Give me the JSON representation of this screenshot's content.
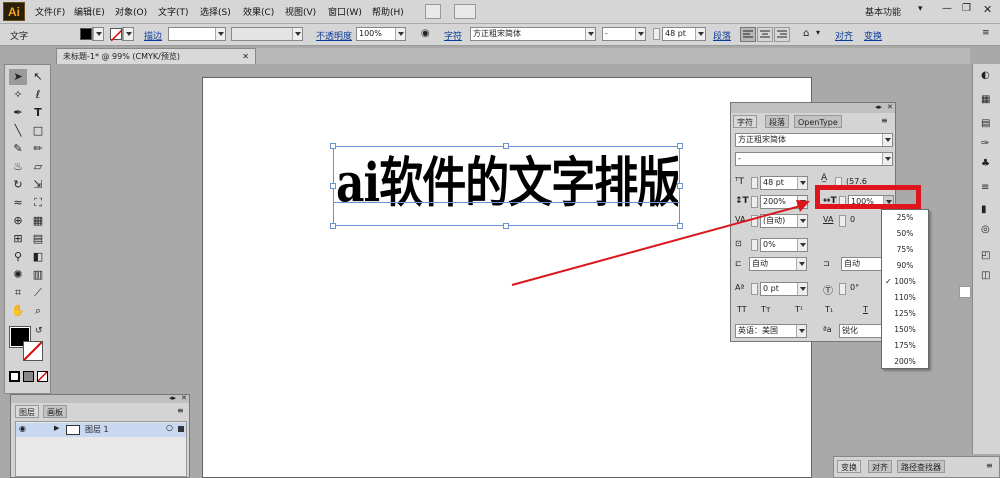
{
  "app": {
    "logo": "Ai",
    "workspace": "基本功能"
  },
  "menu": [
    "文件(F)",
    "编辑(E)",
    "对象(O)",
    "文字(T)",
    "选择(S)",
    "效果(C)",
    "视图(V)",
    "窗口(W)",
    "帮助(H)"
  ],
  "control_bar": {
    "type_label": "文字",
    "stroke_label": "描边",
    "opacity_label": "不透明度",
    "opacity_value": "100%",
    "font_label": "字符",
    "font_value": "方正粗宋简体",
    "style_value": "-",
    "size_value": "48 pt",
    "paragraph_label": "段落",
    "align_label": "对齐",
    "transform_label": "变换"
  },
  "document": {
    "tab_title": "未标题-1* @ 99% (CMYK/预览)",
    "canvas_text": "ai软件的文字排版教学"
  },
  "character_panel": {
    "tabs": [
      "字符",
      "段落",
      "OpenType"
    ],
    "font_family": "方正粗宋简体",
    "font_style": "-",
    "font_size": "48 pt",
    "leading": "(57.6",
    "vertical_scale": "200%",
    "horizontal_scale": "100%",
    "kerning": "(自动)",
    "tracking": "0",
    "tsume": "0%",
    "aki_left": "自动",
    "aki_right": "自动",
    "baseline_shift": "0 pt",
    "rotation": "0°",
    "style_buttons": [
      "TT",
      "Tт",
      "T¹",
      "T₁",
      "T"
    ],
    "language": "英语：美国",
    "antialias_icon": "ªa",
    "antialias": "锐化"
  },
  "scale_dropdown": {
    "options": [
      "25%",
      "50%",
      "75%",
      "90%",
      "100%",
      "110%",
      "125%",
      "150%",
      "175%",
      "200%"
    ],
    "selected": "100%",
    "check": "✓"
  },
  "layers_panel": {
    "tabs": [
      "图层",
      "画板"
    ],
    "layer_name": "图层 1"
  },
  "bottom_panel": {
    "tabs": [
      "变换",
      "对齐",
      "路径查找器"
    ]
  },
  "colors": {
    "highlight_red": "#e0141b",
    "arrow_red": "#d9171d",
    "selection_blue": "#4a7fd4"
  }
}
